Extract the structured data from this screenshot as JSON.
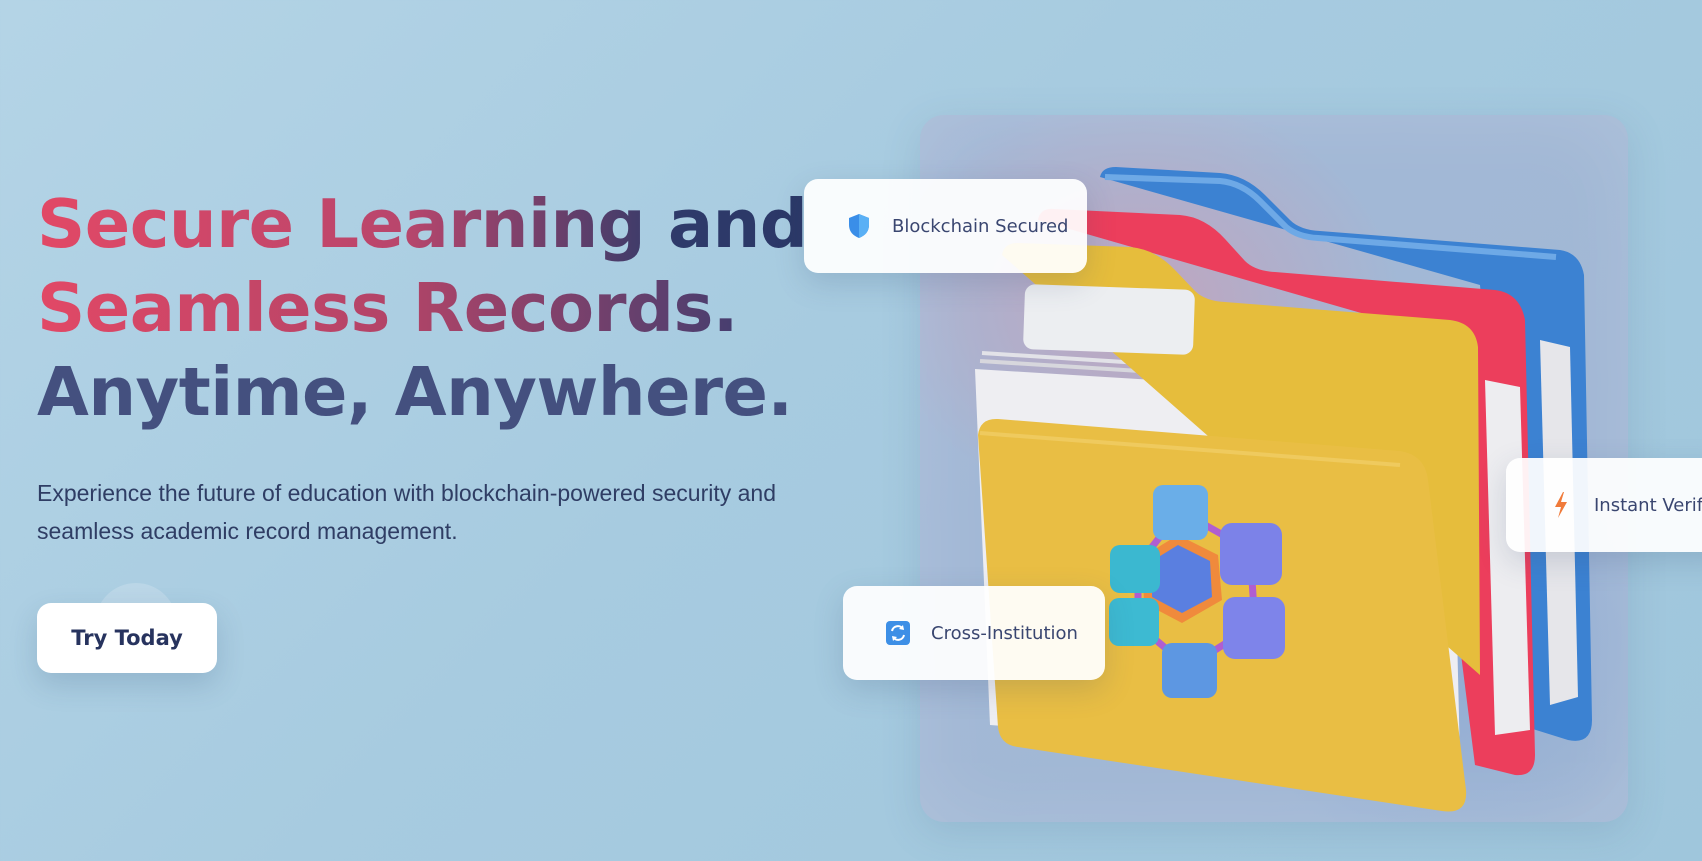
{
  "hero": {
    "headline_line1_a": "Secure Learning",
    "headline_line1_b": "and",
    "headline_line2": "Seamless Records.",
    "headline_line3": "Anytime, Anywhere.",
    "subtitle_line1": "Experience the future of education with blockchain-powered security and",
    "subtitle_line2": "seamless academic record management.",
    "cta_label": "Try Today"
  },
  "badges": [
    {
      "label": "Blockchain Secured",
      "icon": "shield-icon"
    },
    {
      "label": "Cross-Institution",
      "icon": "sync-icon"
    },
    {
      "label": "Instant Verif",
      "icon": "lightning-icon"
    }
  ],
  "colors": {
    "background": "#a9cde1",
    "headline_pink": "#e24866",
    "headline_navy": "#2a3766",
    "headline_slate": "#44507f",
    "text": "#2f3d64",
    "cta_bg": "#ffffff"
  }
}
